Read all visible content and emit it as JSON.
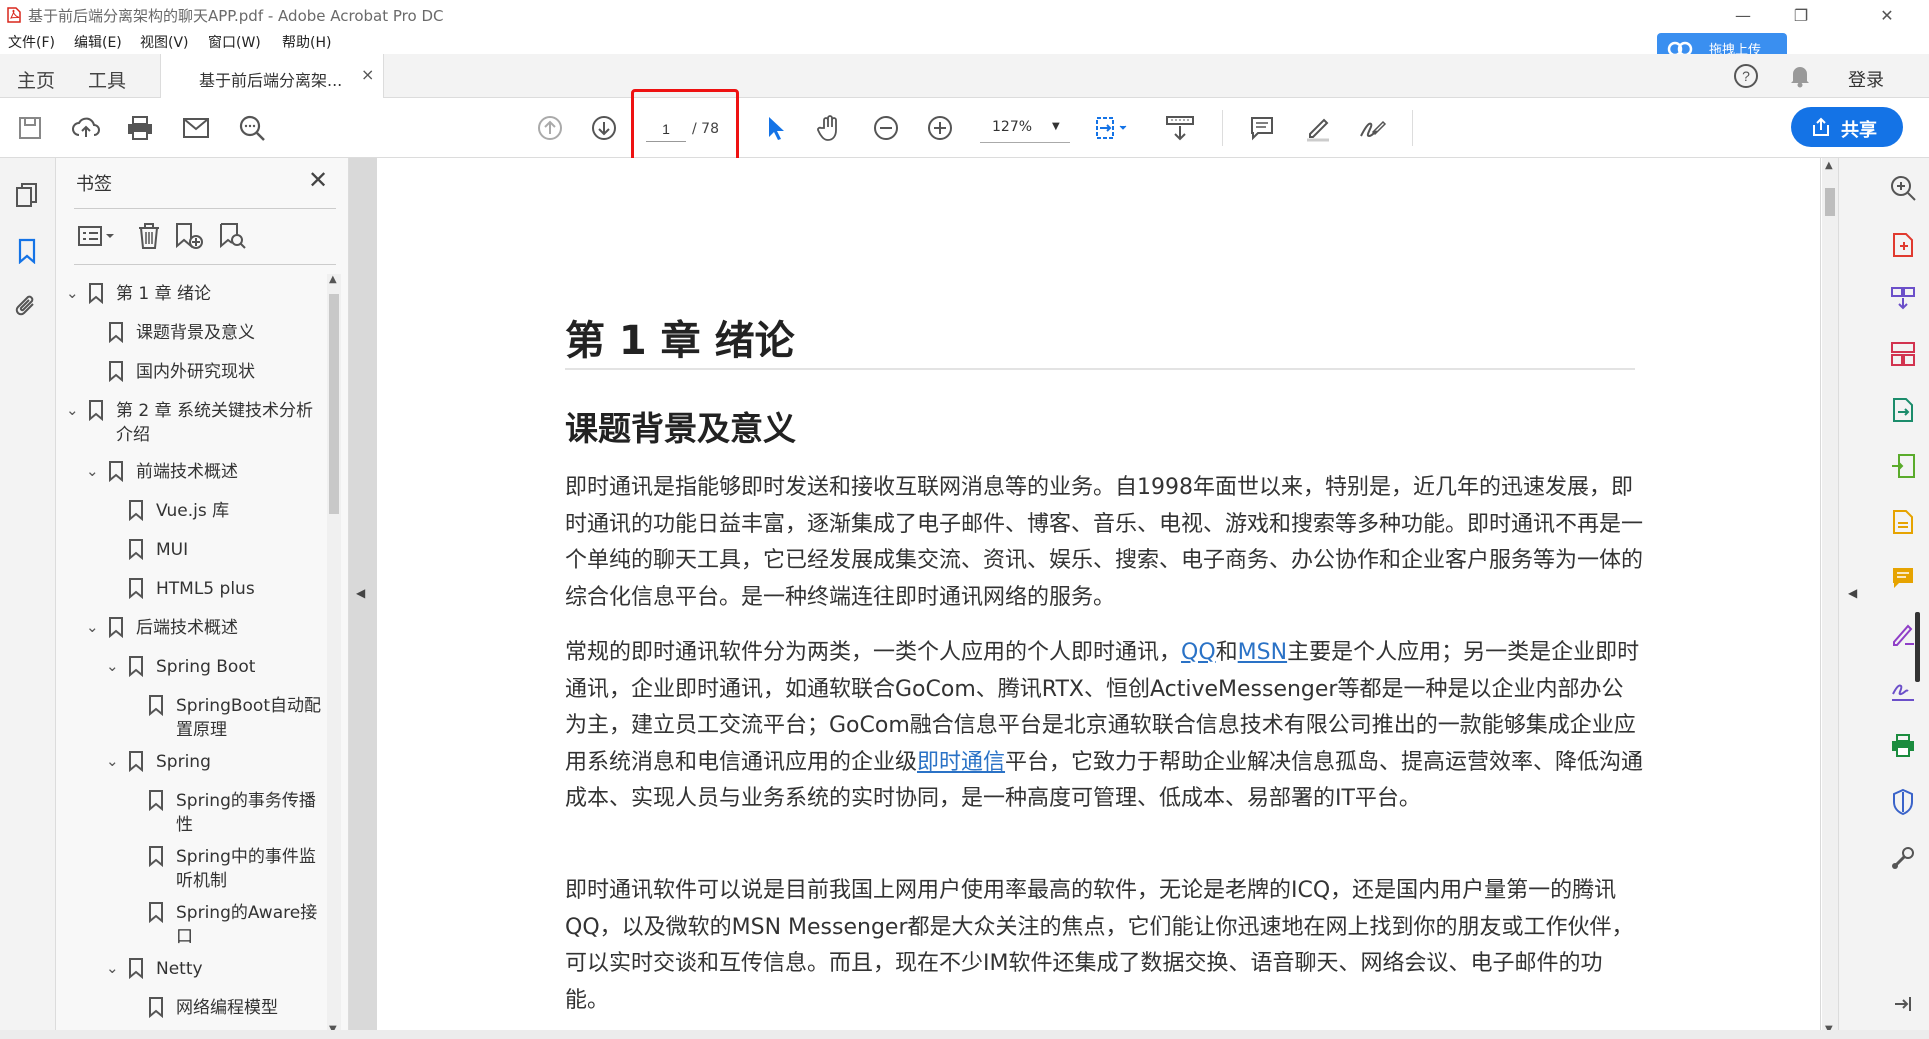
{
  "window": {
    "title": "基于前后端分离架构的聊天APP.pdf - Adobe Acrobat Pro DC"
  },
  "menu": [
    "文件(F)",
    "编辑(E)",
    "视图(V)",
    "窗口(W)",
    "帮助(H)"
  ],
  "tabs": {
    "home": "主页",
    "tools": "工具",
    "document": "基于前后端分离架...",
    "close": "×"
  },
  "toolbar": {
    "page_current": "1",
    "page_total": "/ 78",
    "zoom": "127%",
    "share": "共享"
  },
  "cloud": {
    "label": "拖拽上传"
  },
  "account": {
    "login": "登录"
  },
  "bookmarks": {
    "title": "书签",
    "items": [
      {
        "label": "第 1 章 绪论",
        "level": 0,
        "expanded": true
      },
      {
        "label": "课题背景及意义",
        "level": 1
      },
      {
        "label": "国内外研究现状",
        "level": 1
      },
      {
        "label": "第 2 章 系统关键技术分析介绍",
        "level": 0,
        "expanded": true
      },
      {
        "label": "前端技术概述",
        "level": 1,
        "expanded": true
      },
      {
        "label": "Vue.js 库",
        "level": 2
      },
      {
        "label": "MUI",
        "level": 2
      },
      {
        "label": "HTML5 plus",
        "level": 2
      },
      {
        "label": "后端技术概述",
        "level": 1,
        "expanded": true
      },
      {
        "label": "Spring Boot",
        "level": 2,
        "expanded": true
      },
      {
        "label": "SpringBoot自动配置原理",
        "level": 3
      },
      {
        "label": "Spring",
        "level": 2,
        "expanded": true
      },
      {
        "label": "Spring的事务传播性",
        "level": 3
      },
      {
        "label": "Spring中的事件监听机制",
        "level": 3
      },
      {
        "label": "Spring的Aware接口",
        "level": 3
      },
      {
        "label": "Netty",
        "level": 2,
        "expanded": true
      },
      {
        "label": "网络编程模型",
        "level": 3
      }
    ]
  },
  "document": {
    "h1": "第 1 章 绪论",
    "h2": "课题背景及意义",
    "p1": "即时通讯是指能够即时发送和接收互联网消息等的业务。自1998年面世以来，特别是，近几年的迅速发展，即时通讯的功能日益丰富，逐渐集成了电子邮件、博客、音乐、电视、游戏和搜索等多种功能。即时通讯不再是一个单纯的聊天工具，它已经发展成集交流、资讯、娱乐、搜索、电子商务、办公协作和企业客户服务等为一体的综合化信息平台。是一种终端连往即时通讯网络的服务。",
    "p2_a": "常规的即时通讯软件分为两类，一类个人应用的个人即时通讯，",
    "p2_link1": "QQ",
    "p2_and": "和",
    "p2_link2": "MSN",
    "p2_b": "主要是个人应用；另一类是企业即时通讯，企业即时通讯，如通软联合GoCom、腾讯RTX、恒创ActiveMessenger等都是一种是以企业内部办公为主，建立员工交流平台；GoCom融合信息平台是北京通软联合信息技术有限公司推出的一款能够集成企业应用系统消息和电信通讯应用的企业级",
    "p2_link3": "即时通信",
    "p2_c": "平台，它致力于帮助企业解决信息孤岛、提高运营效率、降低沟通成本、实现人员与业务系统的实时协同，是一种高度可管理、低成本、易部署的IT平台。",
    "p3": "即时通讯软件可以说是目前我国上网用户使用率最高的软件，无论是老牌的ICQ，还是国内用户量第一的腾讯QQ，以及微软的MSN Messenger都是大众关注的焦点，它们能让你迅速地在网上找到你的朋友或工作伙伴，可以实时交谈和互传信息。而且，现在不少IM软件还集成了数据交换、语音聊天、网络会议、电子邮件的功能。"
  },
  "colors": {
    "accent": "#1473e6",
    "highlight": "#e11111",
    "link": "#2a72c6"
  }
}
